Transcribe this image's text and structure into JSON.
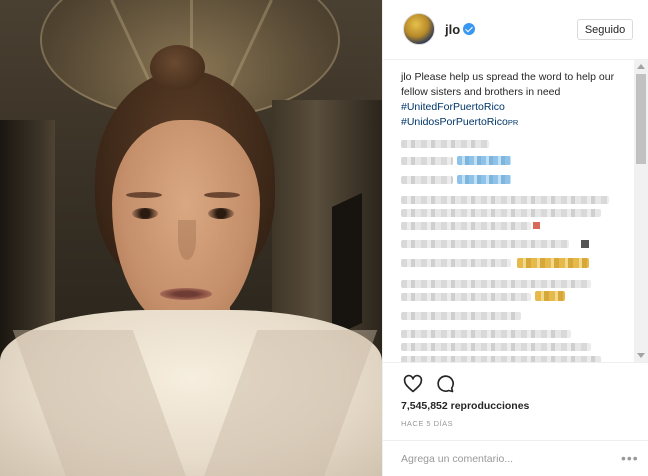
{
  "post": {
    "username": "jlo",
    "verified": true,
    "follow_label": "Seguido",
    "caption_user": "jlo",
    "caption_text": "Please help us spread the word to help our fellow sisters and brothers in need",
    "hashtags": [
      "#UnitedForPuertoRico",
      "#UnidosPorPuertoRico"
    ],
    "hashtag_suffix": "PR",
    "views": "7,545,852 reproducciones",
    "time_ago": "HACE 5 DÍAS"
  },
  "comment_box": {
    "placeholder": "Agrega un comentario...",
    "more_icon": "ellipsis-icon"
  },
  "icons": {
    "like": "heart-icon",
    "comment": "comment-bubble-icon",
    "verified": "verified-badge-icon"
  },
  "colors": {
    "hashtag": "#003569",
    "verified": "#3897f0",
    "border": "#efefef",
    "meta_text": "#999999"
  }
}
